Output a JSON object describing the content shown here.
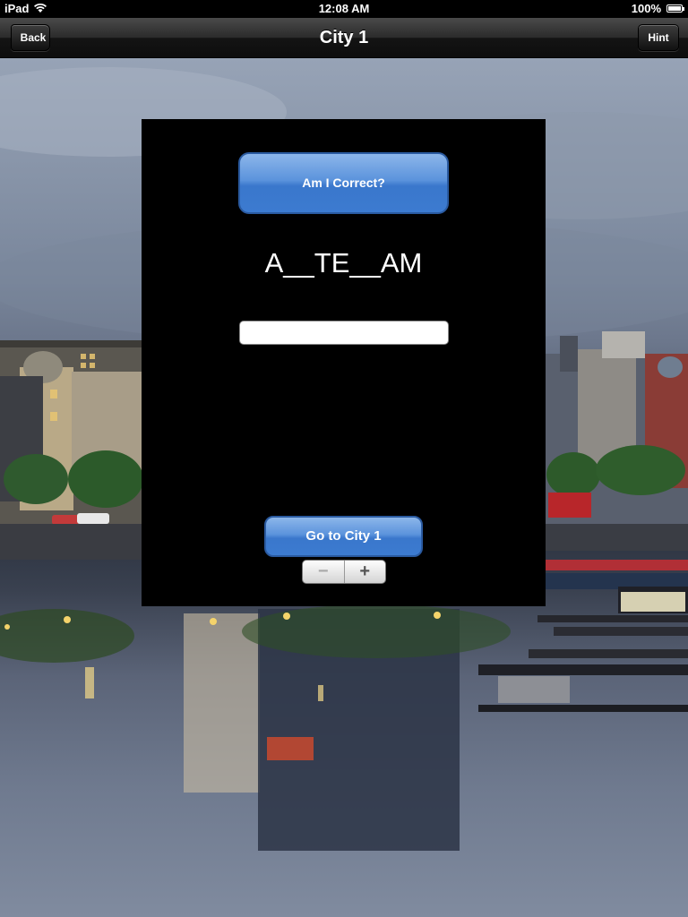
{
  "status_bar": {
    "carrier": "iPad",
    "time": "12:08 AM",
    "battery": "100%"
  },
  "nav": {
    "title": "City 1",
    "back_label": "Back",
    "hint_label": "Hint"
  },
  "quiz": {
    "check_label": "Am I Correct?",
    "puzzle": "A__TE__AM",
    "answer_value": "",
    "go_label": "Go to City 1",
    "stepper_minus": "−",
    "stepper_plus": "+"
  },
  "colors": {
    "button_blue": "#3a77cc",
    "dialog_bg": "#000000"
  },
  "icons": [
    "wifi-icon",
    "battery-icon"
  ]
}
